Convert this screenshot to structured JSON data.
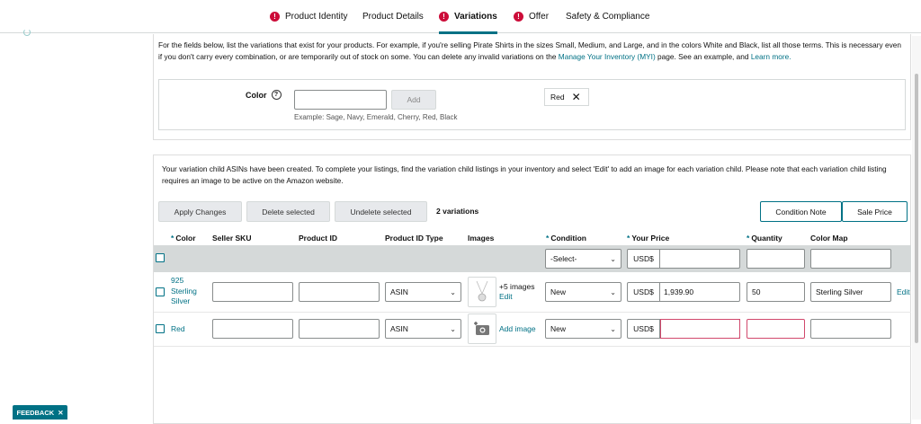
{
  "tabs": [
    {
      "label": "Product Identity",
      "warning": true
    },
    {
      "label": "Product Details",
      "warning": false
    },
    {
      "label": "Variations",
      "warning": true,
      "active": true
    },
    {
      "label": "Offer",
      "warning": true
    },
    {
      "label": "Safety & Compliance",
      "warning": false
    }
  ],
  "intro": {
    "text": "For the fields below, list the variations that exist for your products. For example, if you're selling Pirate Shirts in the sizes Small, Medium, and Large, and in the colors White and Black, list all those terms. This is necessary even if you don't carry every combination, or are temporarily out of stock on some. You can delete any invalid variations on the ",
    "link1": "Manage Your Inventory (MYI)",
    "mid": " page. See an example, and ",
    "link2": "Learn more."
  },
  "color_theme": {
    "label": "Color",
    "input_value": "",
    "add_button": "Add",
    "example": "Example: Sage, Navy, Emerald, Cherry, Red, Black",
    "chips": [
      "Red"
    ]
  },
  "notice": "Your variation child ASINs have been created. To complete your listings, find the variation child listings in your inventory and select 'Edit' to add an image for each variation child. Please note that each variation child listing requires an image to be active on the Amazon website.",
  "toolbar": {
    "apply": "Apply Changes",
    "delete": "Delete selected",
    "undelete": "Undelete selected",
    "count": "2 variations",
    "condition_note": "Condition Note",
    "sale_price": "Sale Price"
  },
  "columns": {
    "color": "Color",
    "seller_sku": "Seller SKU",
    "product_id": "Product ID",
    "product_id_type": "Product ID Type",
    "images": "Images",
    "condition": "Condition",
    "your_price": "Your Price",
    "quantity": "Quantity",
    "color_map": "Color Map"
  },
  "bulk_row": {
    "condition": "-Select-",
    "currency": "USD$"
  },
  "rows": [
    {
      "color_line1": "925",
      "color_line2": "Sterling",
      "color_line3": "Silver",
      "seller_sku": "",
      "product_id": "",
      "id_type": "ASIN",
      "images_text": "+5 images",
      "images_link": "Edit",
      "condition": "New",
      "currency": "USD$",
      "price": "1,939.90",
      "quantity": "50",
      "color_map": "Sterling Silver",
      "edit": "Edit"
    },
    {
      "color_line1": "Red",
      "seller_sku": "",
      "product_id": "",
      "id_type": "ASIN",
      "images_link": "Add image",
      "condition": "New",
      "currency": "USD$",
      "price": "",
      "quantity": "",
      "color_map": ""
    }
  ],
  "feedback": "FEEDBACK",
  "accent": "#007185",
  "warning_color": "#cc0c39"
}
